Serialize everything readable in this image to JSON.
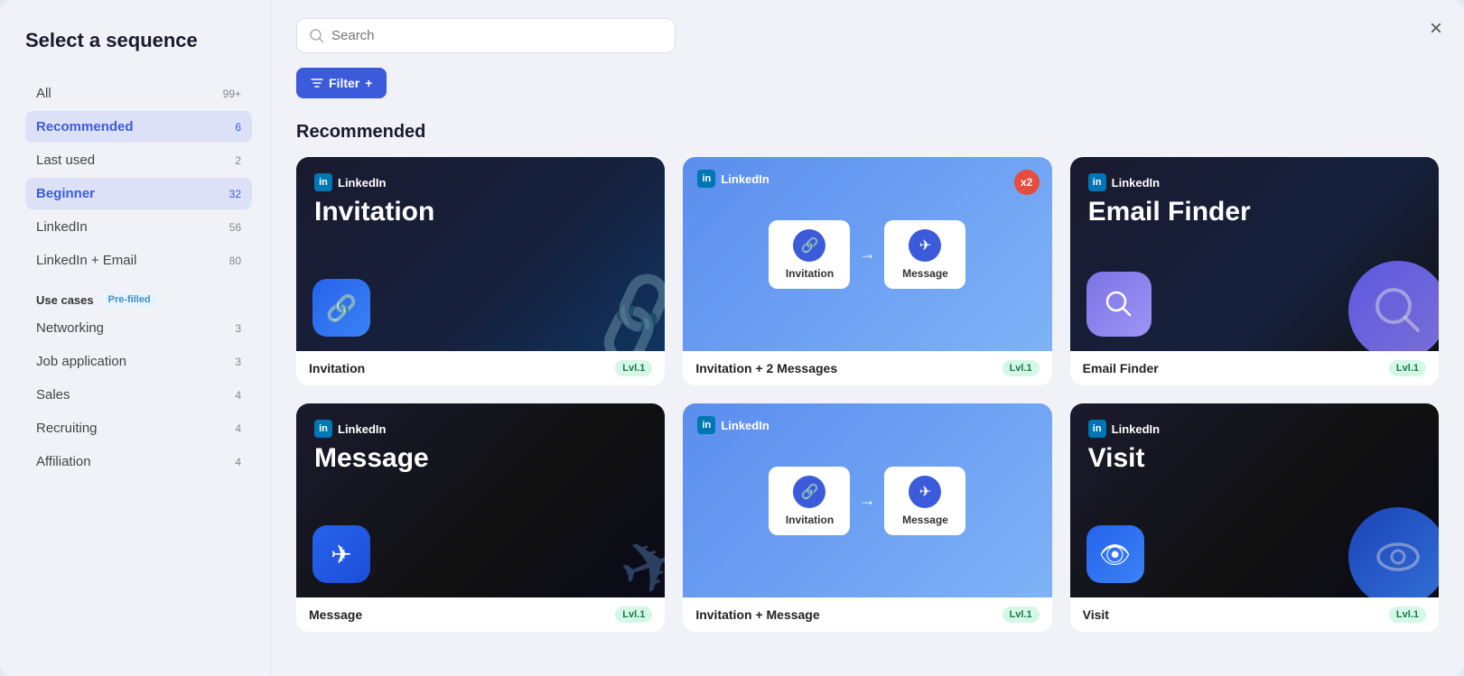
{
  "modal": {
    "title": "Select a sequence"
  },
  "close_btn": "×",
  "search": {
    "placeholder": "Search"
  },
  "filter_btn": {
    "label": "Filter",
    "icon": "filter-icon"
  },
  "sidebar": {
    "section_header": "Select a sequence",
    "items": [
      {
        "id": "all",
        "label": "All",
        "count": "99+",
        "active": false
      },
      {
        "id": "recommended",
        "label": "Recommended",
        "count": "6",
        "active": true
      },
      {
        "id": "last-used",
        "label": "Last used",
        "count": "2",
        "active": false
      },
      {
        "id": "beginner",
        "label": "Beginner",
        "count": "32",
        "active": true
      },
      {
        "id": "linkedin",
        "label": "LinkedIn",
        "count": "56",
        "active": false
      },
      {
        "id": "linkedin-email",
        "label": "LinkedIn + Email",
        "count": "80",
        "active": false
      }
    ],
    "use_cases_label": "Use cases",
    "pre_filled_badge": "Pre-filled",
    "use_case_items": [
      {
        "id": "networking",
        "label": "Networking",
        "count": "3"
      },
      {
        "id": "job-application",
        "label": "Job application",
        "count": "3"
      },
      {
        "id": "sales",
        "label": "Sales",
        "count": "4"
      },
      {
        "id": "recruiting",
        "label": "Recruiting",
        "count": "4"
      },
      {
        "id": "affiliation",
        "label": "Affiliation",
        "count": "4"
      }
    ]
  },
  "main": {
    "section_title": "Recommended",
    "cards": [
      {
        "id": "invitation",
        "title": "Invitation",
        "linkedin_label": "LinkedIn",
        "level": "Lvl.1",
        "type": "invitation"
      },
      {
        "id": "invitation-2-messages",
        "title": "Invitation + 2 Messages",
        "linkedin_label": "LinkedIn",
        "level": "Lvl.1",
        "type": "two-step",
        "x2": "x2",
        "step1": "Invitation",
        "step2": "Message"
      },
      {
        "id": "email-finder",
        "title": "Email Finder",
        "linkedin_label": "LinkedIn",
        "level": "Lvl.1",
        "type": "email-finder"
      },
      {
        "id": "message",
        "title": "Message",
        "linkedin_label": "LinkedIn",
        "level": "Lvl.1",
        "type": "message"
      },
      {
        "id": "invitation-message",
        "title": "Invitation + Message",
        "linkedin_label": "LinkedIn",
        "level": "Lvl.1",
        "type": "two-step-2",
        "step1": "Invitation",
        "step2": "Message"
      },
      {
        "id": "visit",
        "title": "Visit",
        "linkedin_label": "LinkedIn",
        "level": "Lvl.1",
        "type": "visit"
      }
    ]
  }
}
